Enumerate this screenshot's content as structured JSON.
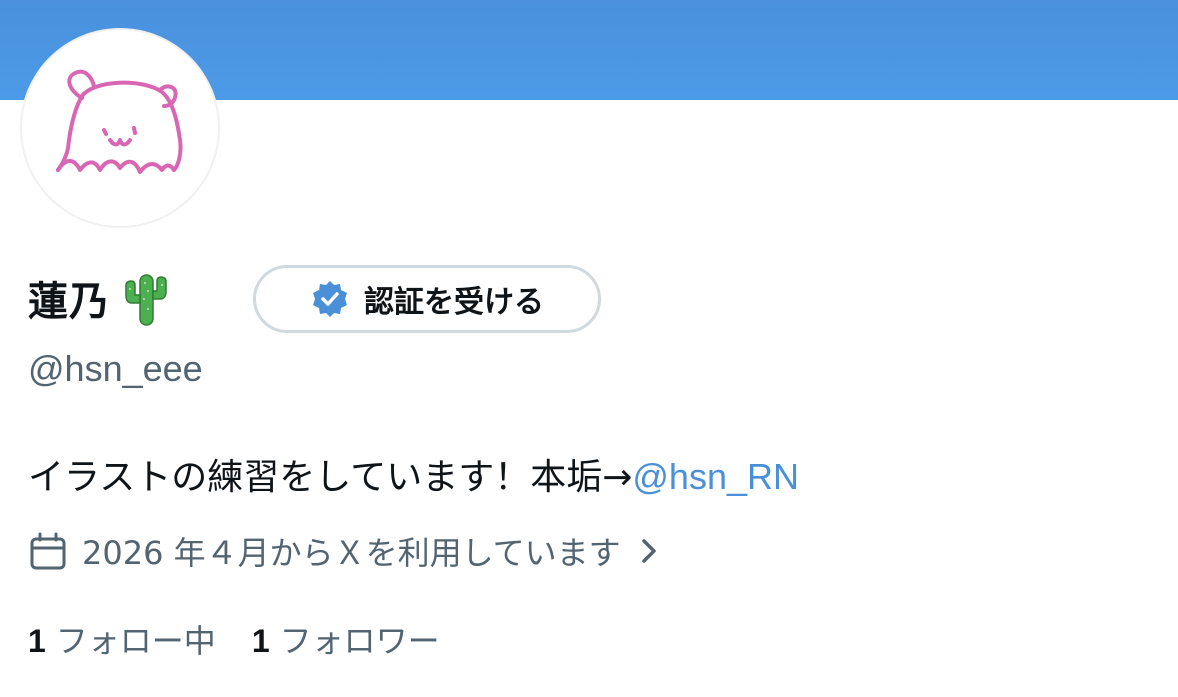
{
  "profile": {
    "display_name": "蓮乃",
    "name_emoji": "cactus",
    "handle": "@hsn_eee",
    "bio_text": "イラストの練習をしています！本垢→",
    "bio_mention": "@hsn_RN",
    "joined": "2026 年４月からＸを利用しています",
    "following_count": "1",
    "following_label": "フォロー中",
    "followers_count": "1",
    "followers_label": "フォロワー"
  },
  "verify_button": {
    "label": "認証を受ける",
    "icon": "verified-badge-icon"
  },
  "colors": {
    "banner": "#4a90dc",
    "link": "#4a90d9",
    "muted": "#536471",
    "avatar_drawing": "#d966b3"
  }
}
